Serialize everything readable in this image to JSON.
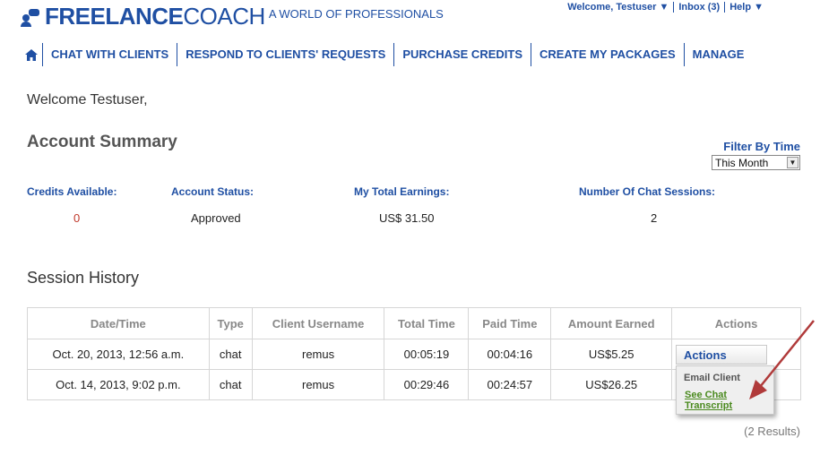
{
  "brand": {
    "logo_bold": "FREELANCE",
    "logo_light": "COACH",
    "tagline": "A WORLD OF PROFESSIONALS"
  },
  "top_links": {
    "welcome": "Welcome, Testuser ▼",
    "inbox": "Inbox (3)",
    "help": "Help ▼"
  },
  "nav": {
    "home_icon": "home-icon",
    "items": [
      "CHAT WITH CLIENTS",
      "RESPOND TO CLIENTS' REQUESTS",
      "PURCHASE CREDITS",
      "CREATE MY PACKAGES",
      "MANAGE"
    ]
  },
  "welcome_text": "Welcome Testuser,",
  "account_summary": {
    "title": "Account Summary",
    "filter_label": "Filter By Time",
    "filter_value": "This Month",
    "labels": {
      "credits": "Credits Available:",
      "status": "Account Status:",
      "earnings": "My Total Earnings:",
      "sessions": "Number Of Chat Sessions:"
    },
    "values": {
      "credits": "0",
      "status": "Approved",
      "earnings": "US$ 31.50",
      "sessions": "2"
    }
  },
  "session_history": {
    "title": "Session History",
    "columns": [
      "Date/Time",
      "Type",
      "Client Username",
      "Total Time",
      "Paid Time",
      "Amount Earned",
      "Actions"
    ],
    "rows": [
      [
        "Oct. 20, 2013, 12:56 a.m.",
        "chat",
        "remus",
        "00:05:19",
        "00:04:16",
        "US$5.25"
      ],
      [
        "Oct. 14, 2013, 9:02 p.m.",
        "chat",
        "remus",
        "00:29:46",
        "00:24:57",
        "US$26.25"
      ]
    ],
    "actions_button": "Actions",
    "actions_menu": {
      "email_client": "Email Client",
      "see_transcript": "See Chat Transcript"
    },
    "results_count": "(2 Results)"
  },
  "colors": {
    "brand_blue": "#1f4fa3",
    "link_green": "#4a8a1e",
    "arrow_red": "#b03a3a",
    "zero_red": "#c0392b"
  }
}
